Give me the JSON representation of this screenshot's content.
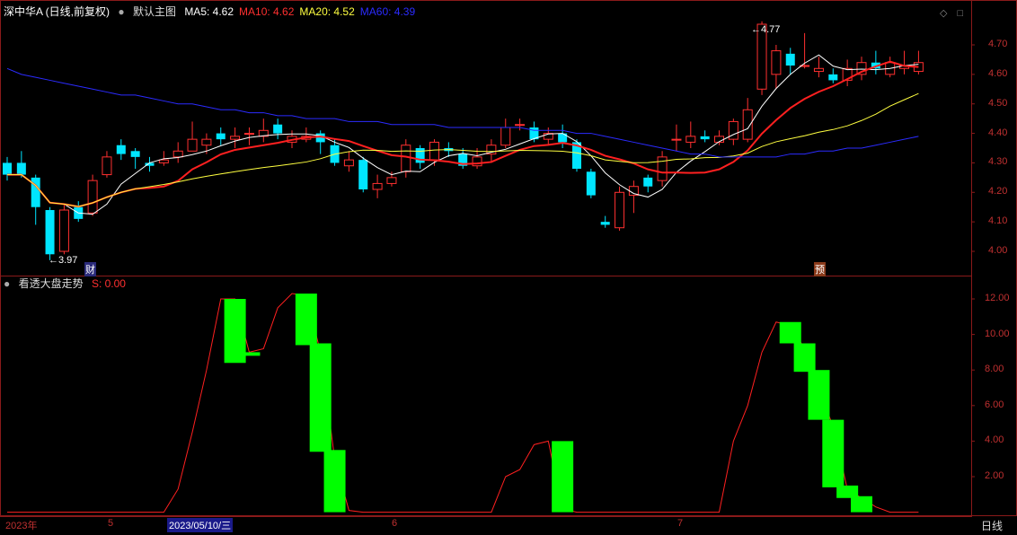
{
  "main_panel": {
    "stock_title": "深中华A (日线,前复权)",
    "template_label": "默认主图",
    "ma": [
      {
        "label": "MA5:",
        "value": "4.62",
        "color": "#ffffff"
      },
      {
        "label": "MA10:",
        "value": "4.62",
        "color": "#ff3030"
      },
      {
        "label": "MA20:",
        "value": "4.52",
        "color": "#ffff40"
      },
      {
        "label": "MA60:",
        "value": "4.39",
        "color": "#2b2bff"
      }
    ],
    "y_ticks": [
      "4.70",
      "4.60",
      "4.50",
      "4.40",
      "4.30",
      "4.20",
      "4.10",
      "4.00"
    ],
    "high_marker": "4.77",
    "low_marker": "3.97",
    "flag_cai": "财",
    "flag_yu": "预"
  },
  "sub_panel": {
    "indicator_name": "看透大盘走势",
    "indicator_value": "S: 0.00",
    "y_ticks": [
      "12.00",
      "10.00",
      "8.00",
      "6.00",
      "4.00",
      "2.00"
    ]
  },
  "x_axis": {
    "labels": [
      "2023年",
      "5",
      "2023/05/10/三",
      "6",
      "7"
    ],
    "period_button": "日线"
  },
  "colors": {
    "up": "#ff3030",
    "down": "#00e5ff",
    "bar": "#00ff00",
    "grid": "#8a1a1a"
  },
  "chart_data": [
    {
      "type": "candlestick",
      "title": "深中华A (日线,前复权)",
      "ylim": [
        3.9,
        4.8
      ],
      "series_ma": [
        {
          "name": "MA5",
          "last": 4.62
        },
        {
          "name": "MA10",
          "last": 4.62
        },
        {
          "name": "MA20",
          "last": 4.52
        },
        {
          "name": "MA60",
          "last": 4.39
        }
      ],
      "candles": [
        [
          4.3,
          4.26,
          4.32,
          4.24
        ],
        [
          4.3,
          4.26,
          4.34,
          4.25
        ],
        [
          4.25,
          4.15,
          4.26,
          4.09
        ],
        [
          4.14,
          3.99,
          4.15,
          3.97
        ],
        [
          4.0,
          4.14,
          4.16,
          3.99
        ],
        [
          4.15,
          4.11,
          4.17,
          4.1
        ],
        [
          4.13,
          4.24,
          4.26,
          4.12
        ],
        [
          4.26,
          4.32,
          4.34,
          4.25
        ],
        [
          4.36,
          4.33,
          4.38,
          4.31
        ],
        [
          4.34,
          4.32,
          4.35,
          4.28
        ],
        [
          4.3,
          4.29,
          4.32,
          4.27
        ],
        [
          4.3,
          4.31,
          4.34,
          4.29
        ],
        [
          4.32,
          4.34,
          4.37,
          4.3
        ],
        [
          4.34,
          4.38,
          4.44,
          4.34
        ],
        [
          4.36,
          4.38,
          4.4,
          4.33
        ],
        [
          4.4,
          4.38,
          4.42,
          4.36
        ],
        [
          4.38,
          4.39,
          4.42,
          4.35
        ],
        [
          4.4,
          4.4,
          4.42,
          4.36
        ],
        [
          4.39,
          4.41,
          4.45,
          4.37
        ],
        [
          4.43,
          4.4,
          4.45,
          4.38
        ],
        [
          4.37,
          4.39,
          4.41,
          4.35
        ],
        [
          4.38,
          4.39,
          4.42,
          4.37
        ],
        [
          4.4,
          4.37,
          4.41,
          4.33
        ],
        [
          4.36,
          4.3,
          4.38,
          4.29
        ],
        [
          4.29,
          4.31,
          4.34,
          4.27
        ],
        [
          4.31,
          4.21,
          4.32,
          4.2
        ],
        [
          4.21,
          4.23,
          4.26,
          4.18
        ],
        [
          4.23,
          4.25,
          4.27,
          4.22
        ],
        [
          4.27,
          4.36,
          4.38,
          4.25
        ],
        [
          4.35,
          4.3,
          4.36,
          4.28
        ],
        [
          4.31,
          4.37,
          4.38,
          4.29
        ],
        [
          4.35,
          4.34,
          4.37,
          4.32
        ],
        [
          4.33,
          4.29,
          4.35,
          4.28
        ],
        [
          4.29,
          4.32,
          4.35,
          4.28
        ],
        [
          4.33,
          4.36,
          4.38,
          4.3
        ],
        [
          4.36,
          4.42,
          4.45,
          4.35
        ],
        [
          4.43,
          4.43,
          4.45,
          4.41
        ],
        [
          4.42,
          4.38,
          4.44,
          4.37
        ],
        [
          4.38,
          4.4,
          4.42,
          4.36
        ],
        [
          4.4,
          4.37,
          4.43,
          4.35
        ],
        [
          4.37,
          4.28,
          4.38,
          4.27
        ],
        [
          4.27,
          4.19,
          4.28,
          4.18
        ],
        [
          4.1,
          4.09,
          4.12,
          4.08
        ],
        [
          4.08,
          4.2,
          4.22,
          4.07
        ],
        [
          4.19,
          4.22,
          4.24,
          4.13
        ],
        [
          4.25,
          4.22,
          4.26,
          4.2
        ],
        [
          4.24,
          4.32,
          4.34,
          4.22
        ],
        [
          4.38,
          4.38,
          4.43,
          4.34
        ],
        [
          4.37,
          4.39,
          4.44,
          4.35
        ],
        [
          4.39,
          4.38,
          4.41,
          4.37
        ],
        [
          4.37,
          4.39,
          4.41,
          4.36
        ],
        [
          4.38,
          4.44,
          4.45,
          4.36
        ],
        [
          4.38,
          4.48,
          4.52,
          4.37
        ],
        [
          4.55,
          4.77,
          4.78,
          4.53
        ],
        [
          4.6,
          4.68,
          4.7,
          4.55
        ],
        [
          4.67,
          4.63,
          4.69,
          4.6
        ],
        [
          4.63,
          4.63,
          4.74,
          4.62
        ],
        [
          4.61,
          4.62,
          4.66,
          4.59
        ],
        [
          4.6,
          4.58,
          4.62,
          4.57
        ],
        [
          4.58,
          4.62,
          4.65,
          4.56
        ],
        [
          4.6,
          4.64,
          4.66,
          4.58
        ],
        [
          4.64,
          4.62,
          4.68,
          4.6
        ],
        [
          4.6,
          4.64,
          4.66,
          4.59
        ],
        [
          4.62,
          4.63,
          4.68,
          4.6
        ],
        [
          4.61,
          4.64,
          4.68,
          4.6
        ]
      ]
    },
    {
      "type": "bar",
      "title": "看透大盘走势",
      "ylim": [
        0,
        12.5
      ],
      "x": [
        16,
        17,
        21,
        22,
        23,
        39,
        55,
        56,
        57,
        58,
        59,
        60
      ],
      "values_top": [
        12.0,
        9.0,
        12.3,
        9.5,
        3.5,
        4.0,
        10.7,
        9.5,
        8.0,
        5.2,
        1.5,
        0.9
      ],
      "values_bottom": [
        8.4,
        8.8,
        9.4,
        3.4,
        0.0,
        0.0,
        9.5,
        7.9,
        5.2,
        1.4,
        0.8,
        0.0
      ]
    }
  ]
}
